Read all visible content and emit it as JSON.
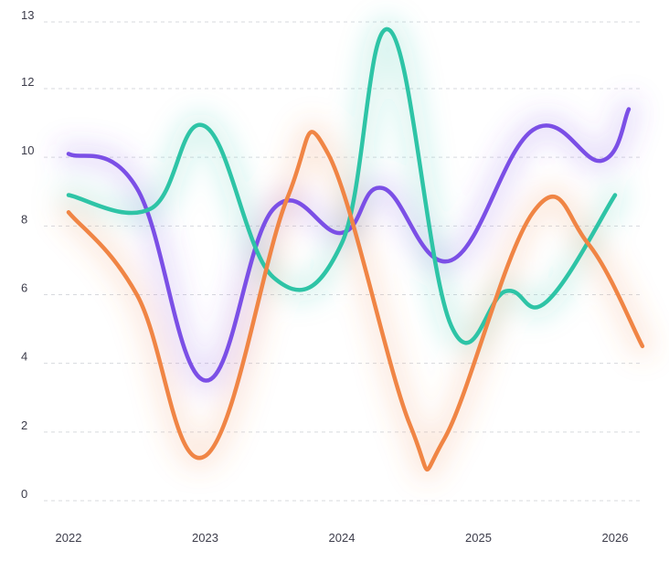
{
  "chart_data": {
    "type": "line",
    "title": "",
    "xlabel": "",
    "ylabel": "",
    "x": [
      2022,
      2022.5,
      2023,
      2023.5,
      2024,
      2024.5,
      2025,
      2025.5,
      2026
    ],
    "x_ticks": [
      "2022",
      "2023",
      "2024",
      "2025",
      "2026"
    ],
    "y_ticks": [
      "0",
      "2",
      "4",
      "6",
      "8",
      "10",
      "12",
      "13"
    ],
    "ylim": [
      0,
      14
    ],
    "grid": true,
    "series": [
      {
        "color": "#7b4fe6",
        "points": [
          [
            2022,
            10.1
          ],
          [
            2022.5,
            9.1
          ],
          [
            2023,
            3.5
          ],
          [
            2023.5,
            8.5
          ],
          [
            2024,
            7.8
          ],
          [
            2024.3,
            9.1
          ],
          [
            2024.8,
            7.0
          ],
          [
            2025.4,
            10.8
          ],
          [
            2025.9,
            9.9
          ],
          [
            2026.1,
            11.4
          ]
        ]
      },
      {
        "color": "#2ec4a6",
        "points": [
          [
            2022,
            8.9
          ],
          [
            2022.6,
            8.5
          ],
          [
            2023,
            10.9
          ],
          [
            2023.5,
            6.5
          ],
          [
            2024,
            7.5
          ],
          [
            2024.35,
            13.7
          ],
          [
            2024.8,
            5.1
          ],
          [
            2025.2,
            6.1
          ],
          [
            2025.5,
            5.8
          ],
          [
            2026,
            8.9
          ]
        ]
      },
      {
        "color": "#f08545",
        "points": [
          [
            2022,
            8.4
          ],
          [
            2022.5,
            6.0
          ],
          [
            2023,
            1.3
          ],
          [
            2023.6,
            8.8
          ],
          [
            2023.9,
            10.1
          ],
          [
            2024.5,
            2.2
          ],
          [
            2024.75,
            1.8
          ],
          [
            2025.4,
            8.4
          ],
          [
            2025.8,
            7.5
          ],
          [
            2026.2,
            4.5
          ]
        ]
      }
    ]
  }
}
